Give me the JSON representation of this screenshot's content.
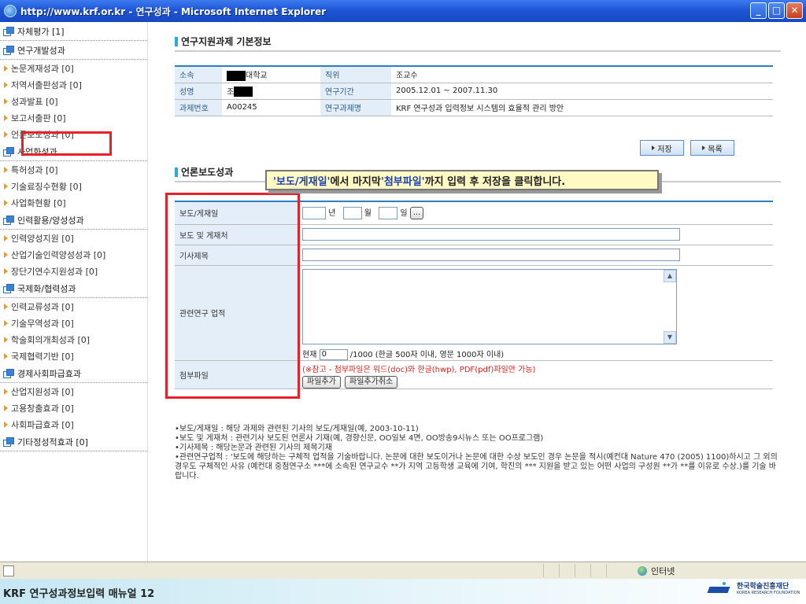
{
  "window": {
    "title": "http://www.krf.or.kr - 연구성과 - Microsoft Internet Explorer",
    "minimize": "_",
    "maximize": "□",
    "close": "✕"
  },
  "sidebar": {
    "sections": [
      {
        "head": "자체평가 [1]",
        "items": []
      },
      {
        "head": "연구개발성과",
        "items": [
          "논문게재성과 [0]",
          "저역서출판성과 [0]",
          "성과발표 [0]",
          "보고서출판 [0]",
          "언론보도성과 [0]"
        ]
      },
      {
        "head": "사업화성과",
        "items": [
          "특허성과 [0]",
          "기술료징수현황 [0]",
          "사업화현황 [0]"
        ]
      },
      {
        "head": "인력활용/양성성과",
        "items": [
          "인력양성지원 [0]",
          "산업기술인력양성성과 [0]",
          "장단기연수지원성과 [0]"
        ]
      },
      {
        "head": "국제화/협력성과",
        "items": [
          "인력교류성과 [0]",
          "기술무역성과 [0]",
          "학술회의개최성과 [0]",
          "국제협력기반 [0]"
        ]
      },
      {
        "head": "경제사회파급효과",
        "items": [
          "산업지원성과 [0]",
          "고용창출효과 [0]",
          "사회파급효과 [0]"
        ]
      },
      {
        "head": "기타정성적효과 [0]",
        "items": []
      }
    ]
  },
  "basic_info": {
    "title": "연구지원과제 기본정보",
    "rows": [
      {
        "l1": "소속",
        "v1": "대학교",
        "l2": "직위",
        "v2": "조교수"
      },
      {
        "l1": "성명",
        "v1": "조",
        "l2": "연구기간",
        "v2": "2005.12.01 ~ 2007.11.30"
      },
      {
        "l1": "과제번호",
        "v1": "A00245",
        "l2": "연구과제명",
        "v2": "KRF 연구성과 입력정보 시스템의 효율적 관리 방안"
      }
    ]
  },
  "buttons": {
    "save": "저장",
    "list": "목록"
  },
  "media": {
    "title": "언론보도성과",
    "callout_prefix": "'보도/게재일'",
    "callout_mid": " 에서 마지막 ",
    "callout_q2": "'첨부파일'",
    "callout_suffix": "까지 입력 후 저장을 클릭합니다.",
    "labels": {
      "date": "보도/게재일",
      "outlet": "보도 및 게재처",
      "article_title": "기사제목",
      "related": "관련연구 업적",
      "attachment": "첨부파일"
    },
    "date_units": {
      "year": "년",
      "month": "월",
      "day": "일",
      "picker": "..."
    },
    "counter": {
      "prefix": "현재",
      "value": "0",
      "suffix": "/1000 (한글 500자 이내, 영문 1000자 이내)"
    },
    "attach_note": "(※참고 - 첨부파일은 워드(doc)와 한글(hwp), PDF(pdf)파일만 가능)",
    "add_file": "파일추가",
    "cancel_file": "파일추가취소"
  },
  "notes": [
    "•보도/게재일 : 해당 과제와 관련된 기사의 보도/게재일(예, 2003-10-11)",
    "•보도 및 게재처 : 관련기사 보도된 언론사 기재(예, 경향신문, OO일보 4면, OO방송9시뉴스 또는 OO프로그램)",
    "•기사제목 : 해당논문과 관련된 기사의 제목기재",
    "•관련연구업적 : '보도에 해당하는 구체적 업적을 기술바랍니다. 논문에 대한 보도이거나 논문에 대한 수상 보도인 경우 논문을 적시(예컨대 Nature 470 (2005) 1100)하시고 그 외의 경우도 구체적인 사유 (예컨대 중점연구소 ***에 소속된 연구교수 **가 지역 고등학생 교육에 기여, 학진의 *** 지원을 받고 있는 어떤 사업의 구성원 **가 **를 이유로 수상.)를 기술 바랍니다."
  ],
  "status": {
    "zone": "인터넷"
  },
  "footer": {
    "caption": "KRF 연구성과정보입력 매뉴얼 12",
    "logo_ko": "한국학술진흥재단",
    "logo_en": "KOREA RESEARCH FOUNDATION"
  }
}
